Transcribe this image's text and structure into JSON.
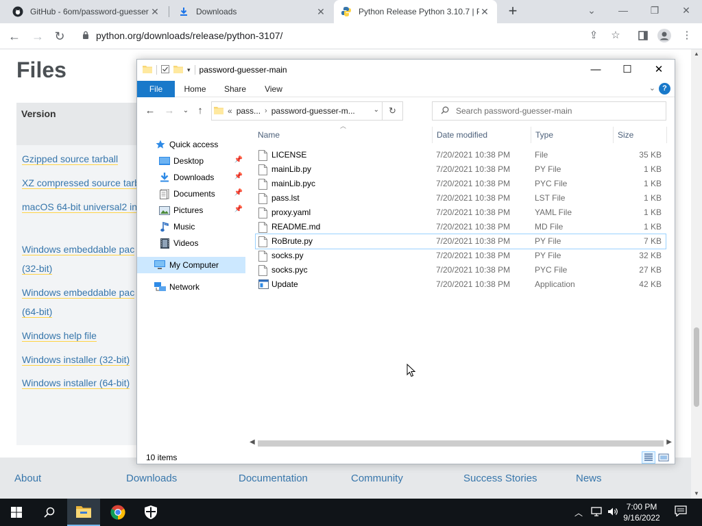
{
  "browser": {
    "tabs": [
      {
        "label": "GitHub - 6om/password-guesser",
        "icon": "github-icon"
      },
      {
        "label": "Downloads",
        "icon": "download-icon"
      },
      {
        "label": "Python Release Python 3.10.7 | Py",
        "icon": "python-icon"
      }
    ],
    "url": "python.org/downloads/release/python-3107/"
  },
  "page": {
    "title": "Files",
    "table_header": "Version",
    "links": [
      "Gzipped source tarball",
      "XZ compressed source tarb",
      "macOS 64-bit universal2 in",
      "Windows embeddable pac",
      "(32-bit)",
      "Windows embeddable pac",
      "(64-bit)",
      "Windows help file",
      "Windows installer (32-bit)",
      "Windows installer (64-bit)"
    ],
    "footer_nav": [
      "About",
      "Downloads",
      "Documentation",
      "Community",
      "Success Stories",
      "News"
    ]
  },
  "explorer": {
    "title": "password-guesser-main",
    "ribbon_tabs": [
      "File",
      "Home",
      "Share",
      "View"
    ],
    "help": "?",
    "address_prefix": "«",
    "address_segments": [
      "pass...",
      "password-guesser-m..."
    ],
    "search_placeholder": "Search password-guesser-main",
    "nav": [
      {
        "label": "Quick access",
        "icon": "star-icon",
        "pinned": false
      },
      {
        "label": "Desktop",
        "icon": "desktop-icon",
        "pinned": true
      },
      {
        "label": "Downloads",
        "icon": "download-icon",
        "pinned": true
      },
      {
        "label": "Documents",
        "icon": "documents-icon",
        "pinned": true
      },
      {
        "label": "Pictures",
        "icon": "pictures-icon",
        "pinned": true
      },
      {
        "label": "Music",
        "icon": "music-icon",
        "pinned": false
      },
      {
        "label": "Videos",
        "icon": "videos-icon",
        "pinned": false
      },
      {
        "label": "My Computer",
        "icon": "computer-icon",
        "pinned": false
      },
      {
        "label": "Network",
        "icon": "network-icon",
        "pinned": false
      }
    ],
    "columns": [
      "Name",
      "Date modified",
      "Type",
      "Size"
    ],
    "files": [
      {
        "name": "LICENSE",
        "date": "7/20/2021 10:38 PM",
        "type": "File",
        "size": "35 KB"
      },
      {
        "name": "mainLib.py",
        "date": "7/20/2021 10:38 PM",
        "type": "PY File",
        "size": "1 KB"
      },
      {
        "name": "mainLib.pyc",
        "date": "7/20/2021 10:38 PM",
        "type": "PYC File",
        "size": "1 KB"
      },
      {
        "name": "pass.lst",
        "date": "7/20/2021 10:38 PM",
        "type": "LST File",
        "size": "1 KB"
      },
      {
        "name": "proxy.yaml",
        "date": "7/20/2021 10:38 PM",
        "type": "YAML File",
        "size": "1 KB"
      },
      {
        "name": "README.md",
        "date": "7/20/2021 10:38 PM",
        "type": "MD File",
        "size": "1 KB"
      },
      {
        "name": "RoBrute.py",
        "date": "7/20/2021 10:38 PM",
        "type": "PY File",
        "size": "7 KB"
      },
      {
        "name": "socks.py",
        "date": "7/20/2021 10:38 PM",
        "type": "PY File",
        "size": "32 KB"
      },
      {
        "name": "socks.pyc",
        "date": "7/20/2021 10:38 PM",
        "type": "PYC File",
        "size": "27 KB"
      },
      {
        "name": "Update",
        "date": "7/20/2021 10:38 PM",
        "type": "Application",
        "size": "42 KB"
      }
    ],
    "item_count": "10 items"
  },
  "taskbar": {
    "time": "7:00 PM",
    "date": "9/16/2022"
  },
  "colors": {
    "python_blue": "#3776ab",
    "explorer_accent": "#1979ca",
    "selection_border": "#99d1ff",
    "taskbar_bg": "#101418"
  }
}
